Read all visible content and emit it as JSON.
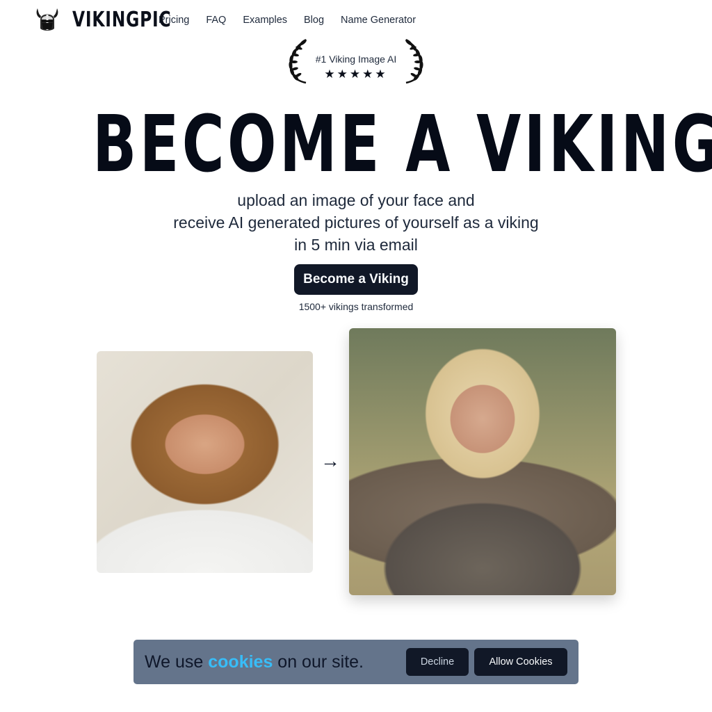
{
  "nav": {
    "logo_icon": "viking-helmet-icon",
    "logo_text": "VIKINGPIC",
    "links": [
      {
        "label": "Pricing"
      },
      {
        "label": "FAQ"
      },
      {
        "label": "Examples"
      },
      {
        "label": "Blog"
      },
      {
        "label": "Name Generator"
      }
    ]
  },
  "badge": {
    "text": "#1 Viking Image AI",
    "stars": "★★★★★",
    "rating": 5,
    "icons": [
      "laurel-left-icon",
      "laurel-right-icon",
      "star-icon"
    ]
  },
  "hero": {
    "title": "BECOME A VIKING",
    "subtitle_lines": [
      "upload an image of your face and",
      "receive AI generated pictures of yourself as a viking",
      "in 5 min via email"
    ],
    "cta_label": "Become a Viking",
    "social_proof": "1500+ vikings transformed"
  },
  "comparison": {
    "before_alt": "Photo of a smiling man with long hair in a white t-shirt",
    "arrow": "→",
    "after_alt": "AI generated viking portrait with blonde braided hair and leather armor"
  },
  "cookie_banner": {
    "text_before": "We use ",
    "link_text": "cookies",
    "text_after": " on our site.",
    "decline_label": "Decline",
    "allow_label": "Allow Cookies"
  },
  "colors": {
    "primary_dark": "#111827",
    "cookie_bg": "#64748b",
    "cookie_link": "#38bdf8"
  }
}
